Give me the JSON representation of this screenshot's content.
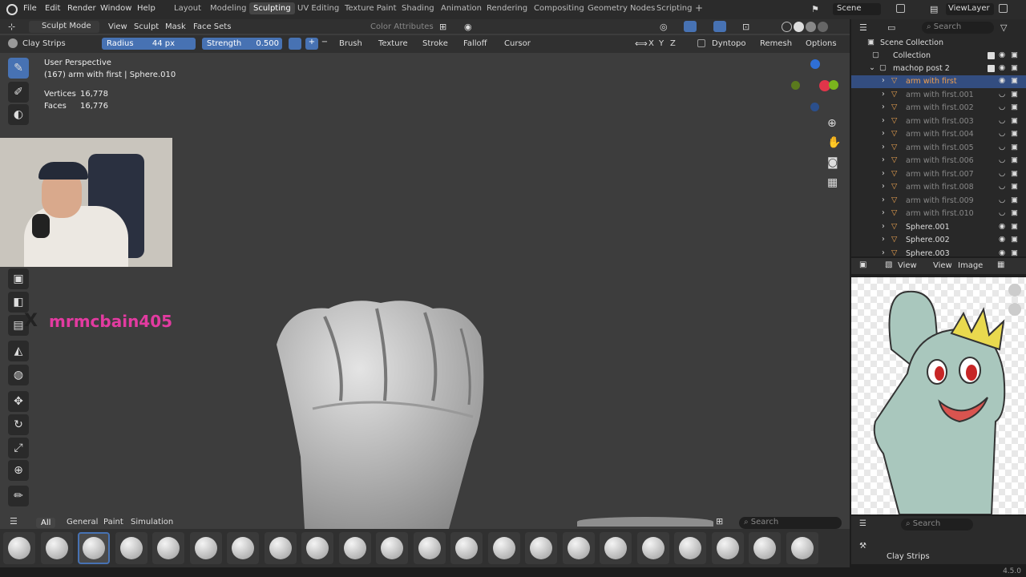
{
  "topbar": {
    "menus": [
      "File",
      "Edit",
      "Render",
      "Window",
      "Help"
    ],
    "workspaces": [
      "Layout",
      "Modeling",
      "Sculpting",
      "UV Editing",
      "Texture Paint",
      "Shading",
      "Animation",
      "Rendering",
      "Compositing",
      "Geometry Nodes",
      "Scripting"
    ],
    "active_workspace": "Sculpting",
    "add_tab": "+",
    "scene": "Scene",
    "view_layer": "ViewLayer"
  },
  "viewport_header": {
    "mode": "Sculpt Mode",
    "menus": [
      "View",
      "Sculpt",
      "Mask",
      "Face Sets"
    ],
    "color_attributes": "Color Attributes"
  },
  "tool_header": {
    "brush_name": "Clay Strips",
    "radius_label": "Radius",
    "radius_value": "44 px",
    "strength_label": "Strength",
    "strength_value": "0.500",
    "plus": "+",
    "minus": "−",
    "menus": [
      "Brush",
      "Texture",
      "Stroke",
      "Falloff",
      "Cursor"
    ],
    "axes": [
      "X",
      "Y",
      "Z"
    ],
    "dyntopo": "Dyntopo",
    "remesh": "Remesh",
    "options": "Options"
  },
  "overlay": {
    "perspective": "User Perspective",
    "object_info": "(167) arm with first | Sphere.010",
    "vertices_label": "Vertices",
    "vertices_value": "16,778",
    "faces_label": "Faces",
    "faces_value": "16,776"
  },
  "webcam": {
    "handle": "mrmcbain405"
  },
  "outliner": {
    "search_placeholder": "Search",
    "scene_collection": "Scene Collection",
    "collection": "Collection",
    "parent": "machop post 2",
    "items": [
      "arm with first",
      "arm with first.001",
      "arm with first.002",
      "arm with first.003",
      "arm with first.004",
      "arm with first.005",
      "arm with first.006",
      "arm with first.007",
      "arm with first.008",
      "arm with first.009",
      "arm with first.010",
      "Sphere.001",
      "Sphere.002",
      "Sphere.003"
    ]
  },
  "image_editor": {
    "menus": [
      "View",
      "View",
      "Image"
    ]
  },
  "brush_bar": {
    "tabs": [
      "All",
      "General",
      "Paint",
      "Simulation"
    ],
    "active_tab": "All",
    "search_placeholder": "Search"
  },
  "properties": {
    "search_placeholder": "Search",
    "brush": "Clay Strips"
  },
  "status": {
    "version": "4.5.0"
  },
  "colors": {
    "accent": "#4772b3",
    "handle_pink": "#e23ba0"
  }
}
